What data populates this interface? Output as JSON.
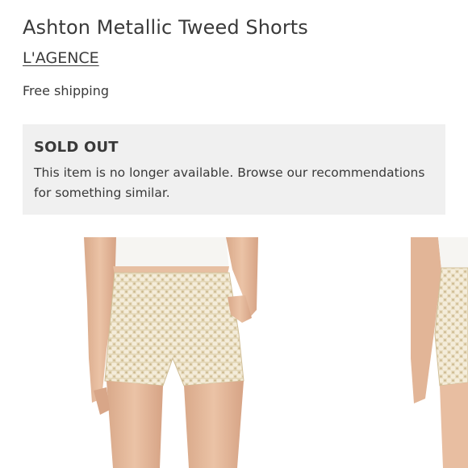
{
  "product": {
    "title": "Ashton Metallic Tweed Shorts",
    "brand": "L'AGENCE",
    "shipping": "Free shipping"
  },
  "availability": {
    "status": "SOLD OUT",
    "message": "This item is no longer available. Browse our recommendations for something similar."
  },
  "gallery": {
    "images": [
      {
        "name": "tweed-shorts-front-view"
      },
      {
        "name": "tweed-shorts-alternate-view"
      }
    ]
  },
  "colors": {
    "notice_background": "#f0f0f0",
    "text": "#393939",
    "shorts_fabric": "#e8dcc0"
  }
}
